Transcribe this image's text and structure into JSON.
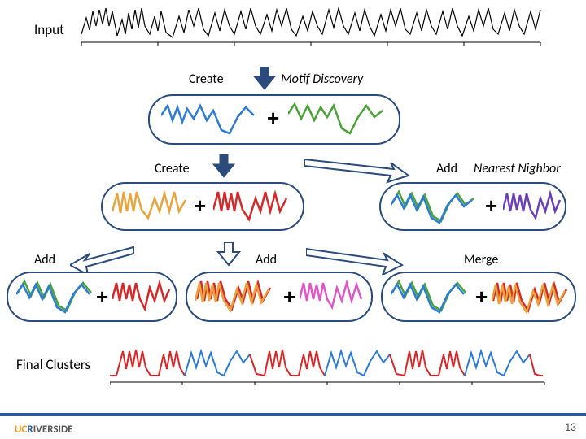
{
  "labels": {
    "input": "Input",
    "create1": "Create",
    "motif": "Motif Discovery",
    "create2": "Create",
    "add_nn": "Add",
    "nn": "Nearest Nighbor",
    "add_left": "Add",
    "add_mid": "Add",
    "merge": "Merge",
    "final": "Final Clusters"
  },
  "page_number": "13",
  "logo": {
    "prefix": "UC",
    "r": "R",
    "rest": "IVERSIDE"
  },
  "colors": {
    "navy": "#2a4b7c",
    "blue": "#2c7bd6",
    "green": "#4aa336",
    "red": "#d62828",
    "gold": "#e8a33d",
    "purple": "#6a3fb5",
    "magenta": "#e056c7",
    "black": "#000"
  }
}
